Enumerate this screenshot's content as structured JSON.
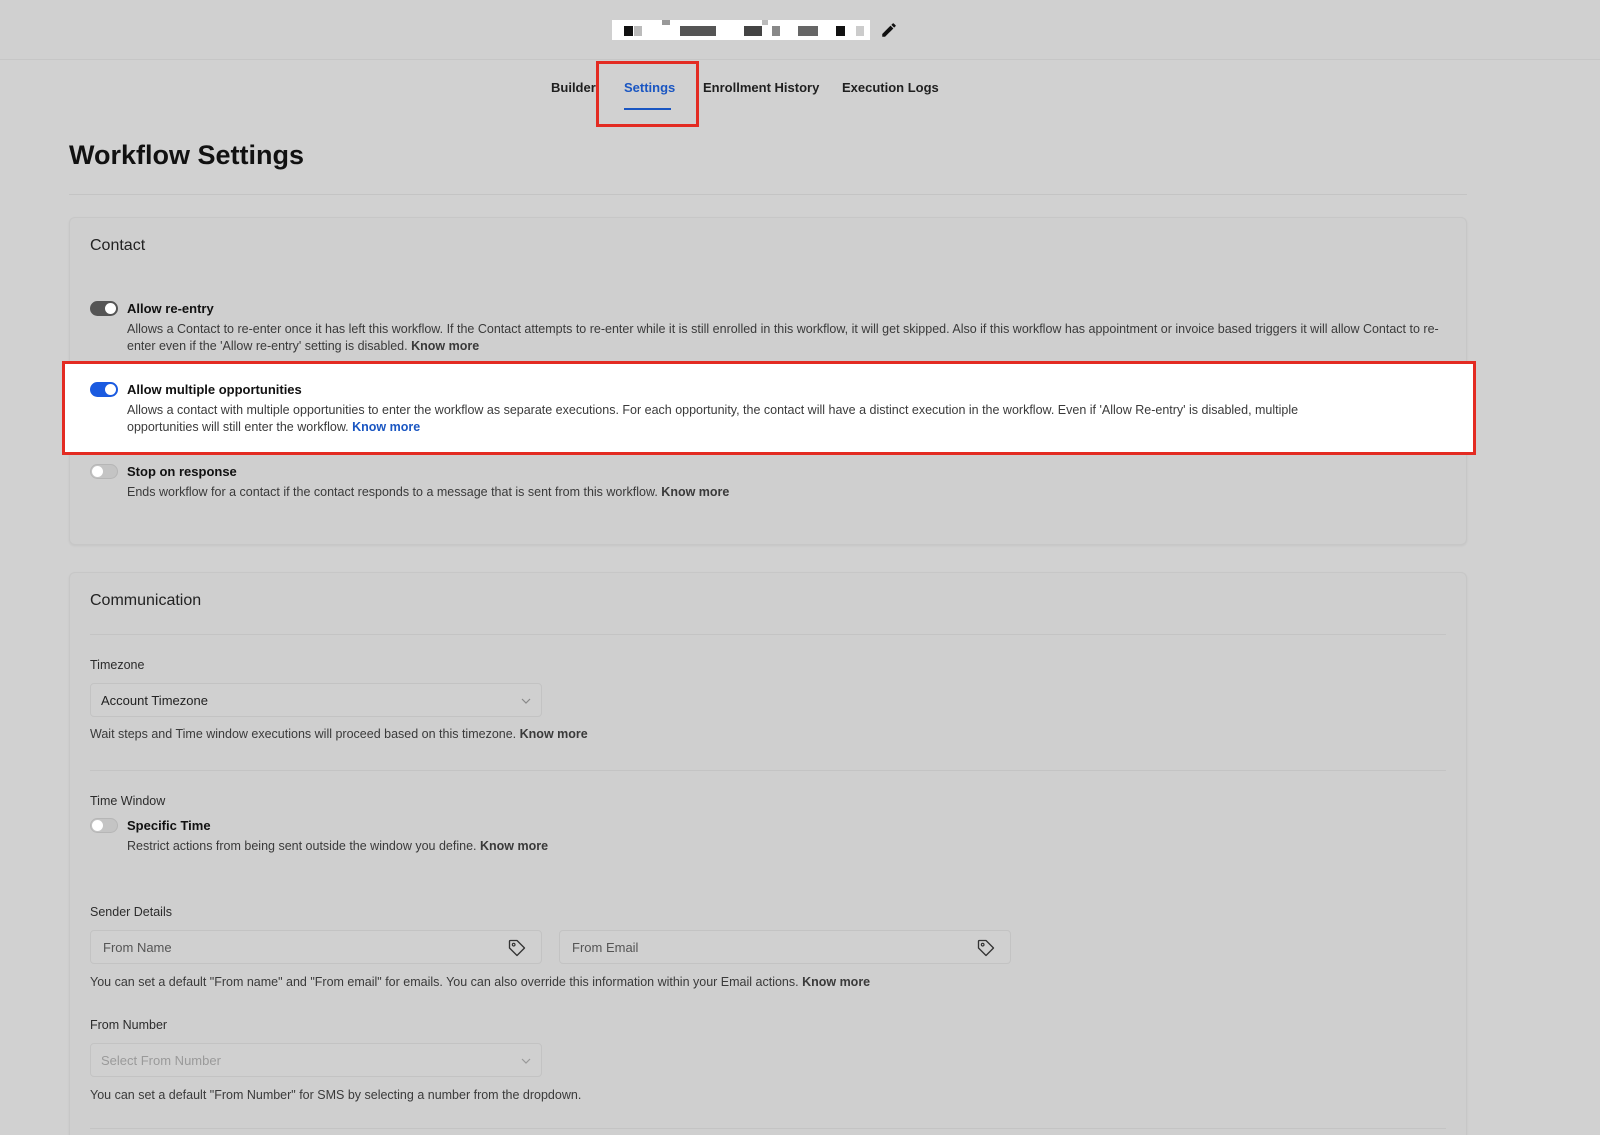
{
  "header": {
    "workflow_name_redacted": true,
    "edit_icon": "pencil-icon"
  },
  "tabs": [
    {
      "label": "Builder"
    },
    {
      "label": "Settings",
      "active": true
    },
    {
      "label": "Enrollment History"
    },
    {
      "label": "Execution Logs"
    }
  ],
  "page": {
    "title": "Workflow Settings"
  },
  "contact": {
    "title": "Contact",
    "options": [
      {
        "label": "Allow re-entry",
        "enabled": true,
        "desc": "Allows a Contact to re-enter once it has left this workflow. If the Contact attempts to re-enter while it is still enrolled in this workflow, it will get skipped. Also if this workflow has appointment or invoice based triggers it will allow Contact to re-enter even if the 'Allow re-entry' setting is disabled.",
        "link": "Know more"
      },
      {
        "label": "Allow multiple opportunities",
        "enabled": true,
        "desc": "Allows a contact with multiple opportunities to enter the workflow as separate executions. For each opportunity, the contact will have a distinct execution in the workflow. Even if 'Allow Re-entry' is disabled, multiple opportunities will still enter the workflow.",
        "link": "Know more"
      },
      {
        "label": "Stop on response",
        "enabled": false,
        "desc": "Ends workflow for a contact if the contact responds to a message that is sent from this workflow.",
        "link": "Know more"
      }
    ]
  },
  "communication": {
    "title": "Communication",
    "timezone": {
      "label": "Timezone",
      "value": "Account Timezone",
      "help": "Wait steps and Time window executions will proceed based on this timezone.",
      "link": "Know more"
    },
    "time_window": {
      "label": "Time Window",
      "toggle_label": "Specific Time",
      "enabled": false,
      "desc": "Restrict actions from being sent outside the window you define.",
      "link": "Know more"
    },
    "sender": {
      "label": "Sender Details",
      "from_name_placeholder": "From Name",
      "from_email_placeholder": "From Email",
      "help": "You can set a default \"From name\" and \"From email\" for emails. You can also override this information within your Email actions.",
      "link": "Know more"
    },
    "from_number": {
      "label": "From Number",
      "placeholder": "Select From Number",
      "help": "You can set a default \"From Number\" for SMS by selecting a number from the dropdown."
    }
  },
  "colors": {
    "accent": "#1a56c2",
    "highlight": "#e32b22",
    "toggle_on": "#1a5ae0"
  }
}
